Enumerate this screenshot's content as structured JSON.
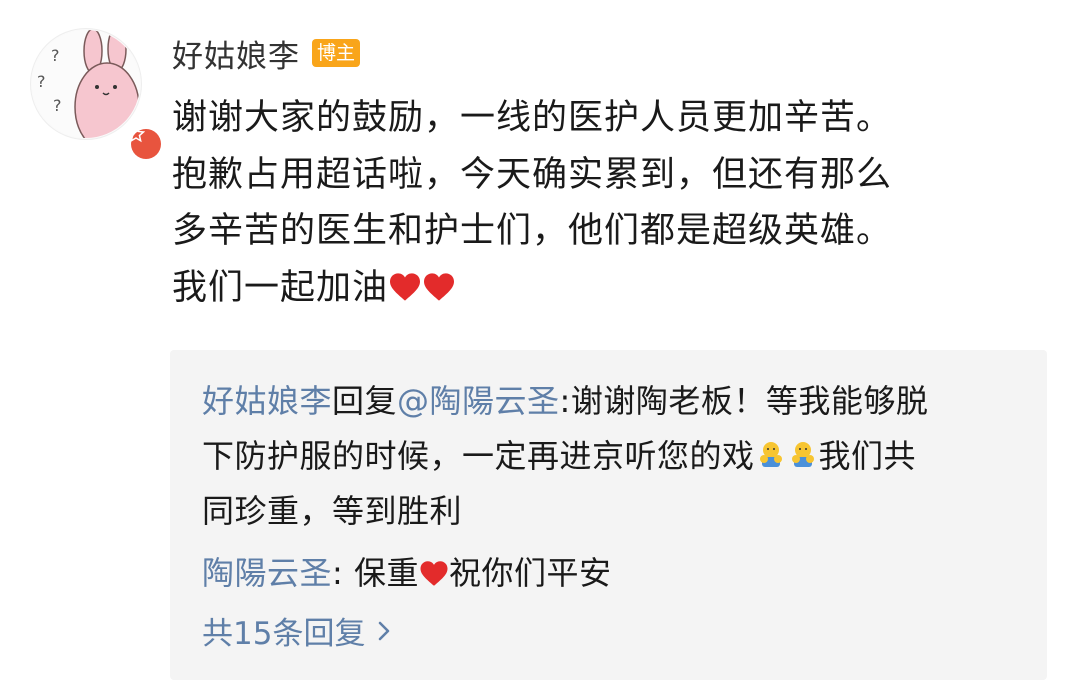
{
  "post": {
    "author": "好姑娘李",
    "badge": "博主",
    "lines": [
      "谢谢大家的鼓励，一线的医护人员更加辛苦。",
      "抱歉占用超话啦，今天确实累到，但还有那么",
      "多辛苦的医生和护士们，他们都是超级英雄。",
      "我们一起加油"
    ]
  },
  "replies": [
    {
      "name": "好姑娘李",
      "verb": "回复",
      "mention": "@陶陽云圣",
      "line1": ":谢谢陶老板！等我能够脱",
      "line2a": "下防护服的时候，一定再进京听您的戏",
      "line2b": "我们共",
      "line3": "同珍重，等到胜利"
    },
    {
      "name": "陶陽云圣",
      "text_a": ": 保重",
      "text_b": "祝你们平安"
    }
  ],
  "more_replies": "共15条回复",
  "icons": {
    "heart": "heart-icon",
    "emoji": "fist-emoji-icon",
    "chevron": "chevron-right-icon"
  },
  "colors": {
    "link_blue": "#5f7fa8",
    "badge_orange": "#f9a51a",
    "heart_red": "#e32b2b",
    "verify_red": "#e8543e"
  }
}
